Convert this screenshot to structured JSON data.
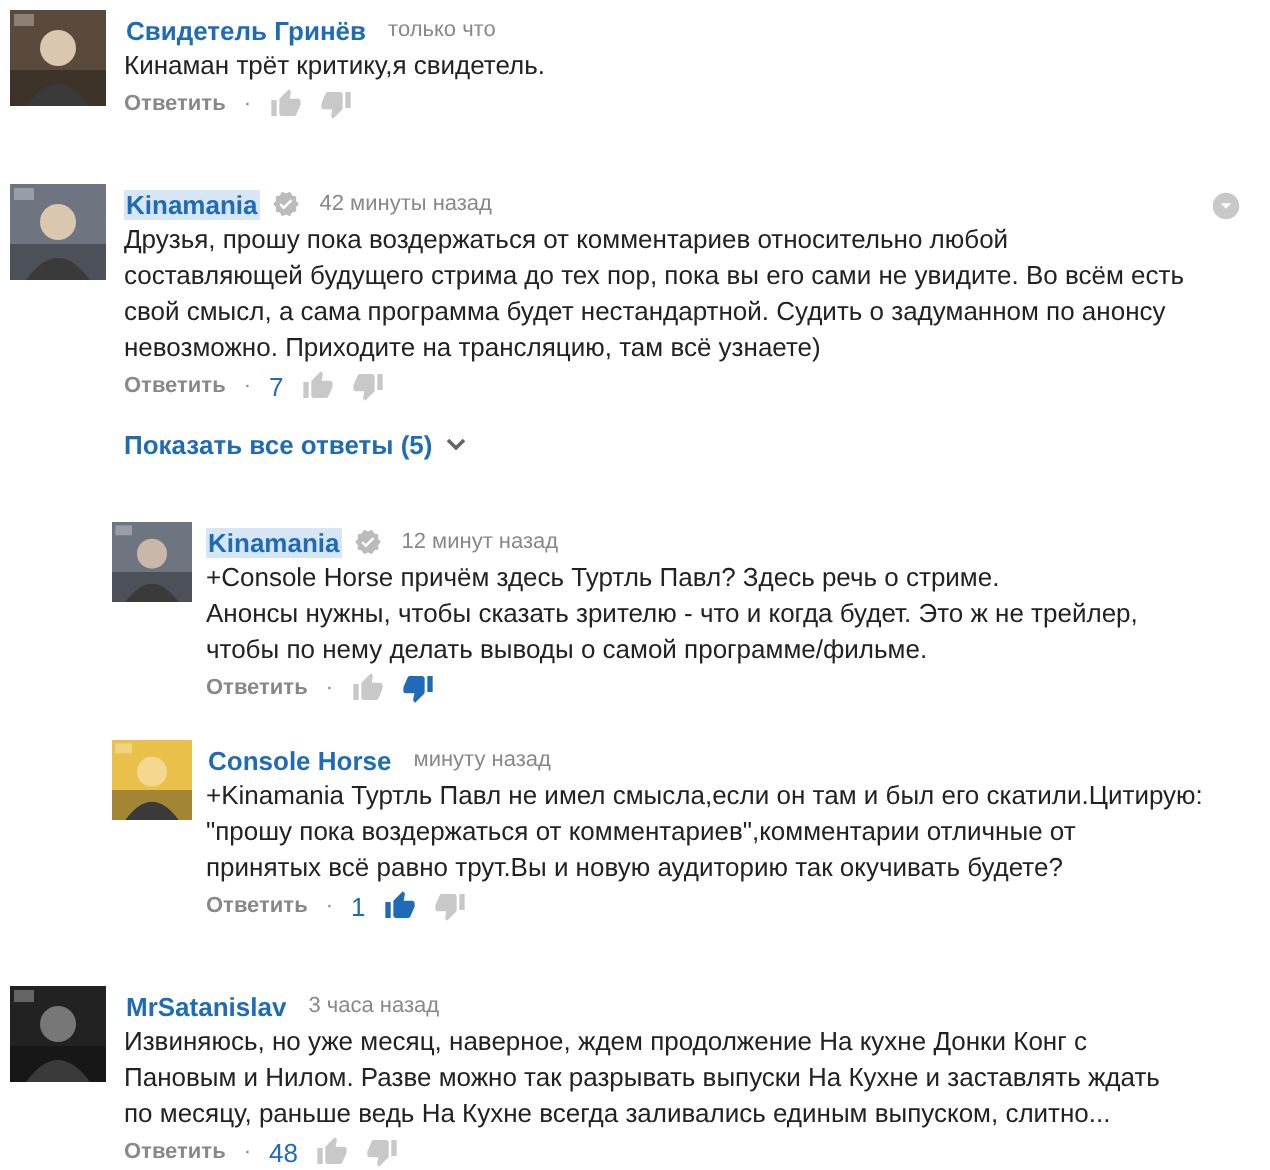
{
  "comments": [
    {
      "author": "Свидетель Гринёв",
      "owner": false,
      "time": "только что",
      "avatar": {
        "kind": "picture"
      },
      "text": [
        "Кинаман трёт критику,я свидетель."
      ],
      "reply_label": "Ответить",
      "separator": "·",
      "liked": false,
      "disliked": false
    },
    {
      "author": "Kinamania",
      "owner": true,
      "verified": true,
      "time": "42 минуты назад",
      "menu": true,
      "avatar": {
        "kind": "picture"
      },
      "text": [
        "Друзья, прошу пока воздержаться от комментариев относительно любой",
        "составляющей будущего стрима до тех пор, пока вы его сами не увидите. Во всём есть",
        "свой смысл, а сама программа будет нестандартной. Судить о задуманном по анонсу",
        "невозможно. Приходите на трансляцию, там всё узнаете)"
      ],
      "reply_label": "Ответить",
      "separator": "·",
      "likes": "7",
      "liked": false,
      "disliked": false,
      "show_replies": "Показать все ответы (5)",
      "replies": [
        {
          "author": "Kinamania",
          "owner": true,
          "verified": true,
          "time": "12 минут назад",
          "avatar": {
            "kind": "picture"
          },
          "text": [
            "+Console Horse причём здесь Туртль Павл? Здесь речь о стриме.",
            "Анонсы нужны, чтобы сказать зрителю - что и когда будет. Это ж не трейлер,",
            "чтобы по нему делать выводы о самой программе/фильме."
          ],
          "reply_label": "Ответить",
          "separator": "·",
          "liked": false,
          "disliked": true
        },
        {
          "author": "Console Horse",
          "owner": false,
          "time": "минуту назад",
          "avatar": {
            "kind": "picture"
          },
          "text": [
            "+Kinamania Туртль Павл не имел смысла,если он там и был его скатили.Цитирую:",
            "\"прошу пока воздержаться от комментариев\",комментарии отличные от",
            "принятых всё равно трут.Вы и новую аудиторию так окучивать будете?"
          ],
          "reply_label": "Ответить",
          "separator": "·",
          "likes": "1",
          "liked": true,
          "disliked": false
        }
      ]
    },
    {
      "author": "MrSatanislav",
      "owner": false,
      "time": "3 часа назад",
      "avatar": {
        "kind": "picture"
      },
      "text": [
        "Извиняюсь, но уже месяц, наверное, ждем продолжение На кухне Донки Конг с",
        "Пановым и Нилом. Разве можно так разрывать выпуски На Кухне и заставлять ждать",
        "по месяцу, раньше ведь На Кухне всегда заливались единым выпуском, слитно..."
      ],
      "reply_label": "Ответить",
      "separator": "·",
      "likes": "48",
      "liked": false,
      "disliked": false
    }
  ]
}
